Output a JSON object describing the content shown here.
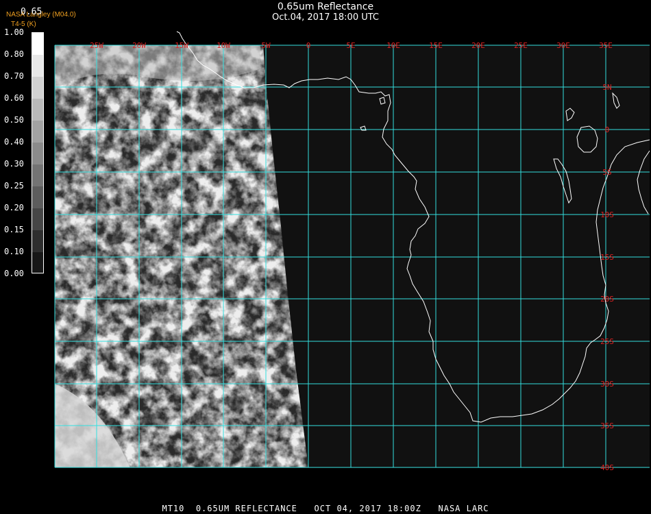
{
  "header": {
    "title": "0.65um Reflectance",
    "datetime": "Oct.04, 2017 18:00 UTC",
    "credit_line1": "NASA Langley (M04.0)",
    "credit_line2": "T4-5 (K)",
    "colorbar_top": "0.65"
  },
  "colorbar": {
    "labels": [
      "1.00",
      "0.80",
      "0.70",
      "0.60",
      "0.50",
      "0.40",
      "0.30",
      "0.25",
      "0.20",
      "0.15",
      "0.10",
      "0.00"
    ]
  },
  "map": {
    "lon_labels": [
      "25W",
      "20W",
      "15W",
      "10W",
      "5W",
      "0",
      "5E",
      "10E",
      "15E",
      "20E",
      "25E",
      "30E",
      "35E"
    ],
    "lat_labels": [
      "5N",
      "0",
      "5S",
      "10S",
      "15S",
      "20S",
      "25S",
      "30S",
      "35S",
      "40S"
    ],
    "grid_color": "#33e0e0",
    "label_color": "#dd2222",
    "coast_color": "#ffffff"
  },
  "footer": {
    "text": "MT10  0.65UM REFLECTANCE   OCT 04, 2017 18:00Z   NASA LARC"
  }
}
